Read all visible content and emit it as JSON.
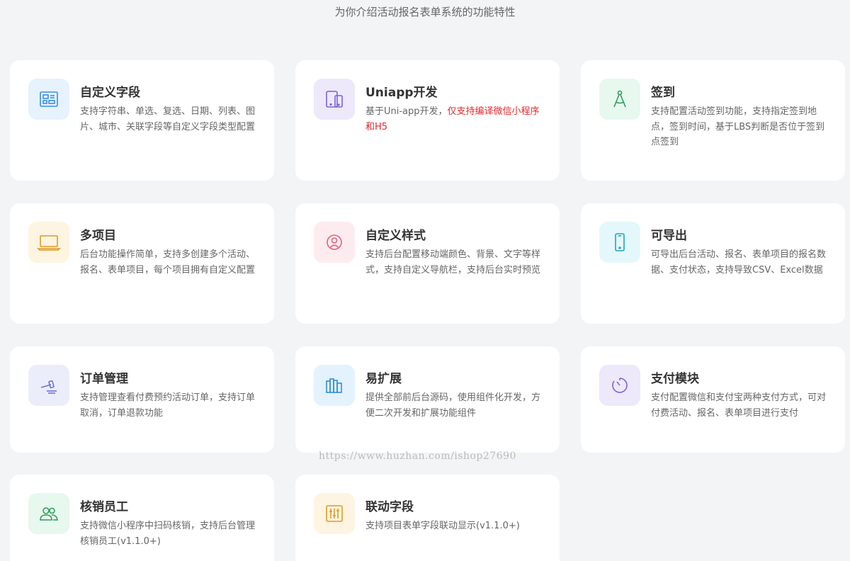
{
  "header": {
    "subtitle": "为你介绍活动报名表单系统的功能特性"
  },
  "features": [
    {
      "title": "自定义字段",
      "desc": "支持字符串、单选、复选、日期、列表、图片、城市、关联字段等自定义字段类型配置",
      "desc_red": "",
      "icon": "form-fields-icon",
      "bg": "#e6f2fd",
      "color": "#3a8ee6"
    },
    {
      "title": "Uniapp开发",
      "desc": "基于Uni-app开发，",
      "desc_red": "仅支持编译微信小程序和H5",
      "icon": "devices-icon",
      "bg": "#ede9fb",
      "color": "#7a63d8"
    },
    {
      "title": "签到",
      "desc": "支持配置活动签到功能，支持指定签到地点，签到时间，基于LBS判断是否位于签到点签到",
      "desc_red": "",
      "icon": "compass-icon",
      "bg": "#e7f8ee",
      "color": "#2f9e5a"
    },
    {
      "title": "多项目",
      "desc": "后台功能操作简单，支持多创建多个活动、报名、表单项目，每个项目拥有自定义配置",
      "desc_red": "",
      "icon": "laptop-icon",
      "bg": "#fdf4e1",
      "color": "#e09a26"
    },
    {
      "title": "自定义样式",
      "desc": "支持后台配置移动端颜色、背景、文字等样式，支持自定义导航栏，支持后台实时预览",
      "desc_red": "",
      "icon": "user-circle-icon",
      "bg": "#fdecef",
      "color": "#e2617b"
    },
    {
      "title": "可导出",
      "desc": "可导出后台活动、报名、表单项目的报名数据、支付状态，支持导致CSV、Excel数据",
      "desc_red": "",
      "icon": "phone-icon",
      "bg": "#e4f8fb",
      "color": "#1da7c0"
    },
    {
      "title": "订单管理",
      "desc": "支持管理查看付费预约活动订单，支持订单取消，订单退款功能",
      "desc_red": "",
      "icon": "gavel-icon",
      "bg": "#ecedfb",
      "color": "#6a72d8"
    },
    {
      "title": "易扩展",
      "desc": "提供全部前后台源码，使用组件化开发，方便二次开发和扩展功能组件",
      "desc_red": "",
      "icon": "books-icon",
      "bg": "#e3f2fd",
      "color": "#2f8fd8"
    },
    {
      "title": "支付模块",
      "desc": "支付配置微信和支付宝两种支付方式，可对付费活动、报名、表单项目进行支付",
      "desc_red": "",
      "icon": "timer-icon",
      "bg": "#ede9fb",
      "color": "#7a63d8"
    },
    {
      "title": "核销员工",
      "desc": "支持微信小程序中扫码核销，支持后台管理核销员工(v1.1.0+)",
      "desc_red": "",
      "icon": "users-icon",
      "bg": "#e7f8ee",
      "color": "#2f9e5a"
    },
    {
      "title": "联动字段",
      "desc": "支持项目表单字段联动显示(v1.1.0+)",
      "desc_red": "",
      "icon": "sliders-icon",
      "bg": "#fdf4e1",
      "color": "#e09a26"
    }
  ],
  "watermark": "https://www.huzhan.com/ishop27690"
}
